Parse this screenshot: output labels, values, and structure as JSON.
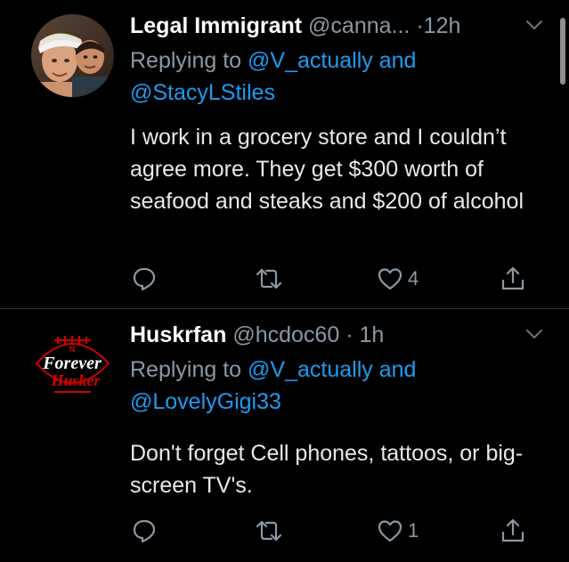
{
  "tweets": [
    {
      "name": "Legal Immigrant",
      "handle": "@canna...",
      "dot": "·",
      "time": "12h",
      "reply_prefix": "Replying to",
      "mention_1": "@V_actually and",
      "mention_2": "@StacyLStiles",
      "body": "I work in a grocery store and I couldn’t agree more. They get $300 worth of seafood and steaks and $200 of alcohol",
      "reply_count": "",
      "retweet_count": "",
      "like_count": "4"
    },
    {
      "name": "Huskrfan",
      "handle": "@hcdoc60",
      "dot": "·",
      "time": "1h",
      "reply_prefix": "Replying to",
      "mention_1": "@V_actually and",
      "mention_2": "@LovelyGigi33",
      "body": "Don't forget Cell phones, tattoos, or big-screen TV's.",
      "reply_count": "",
      "retweet_count": "",
      "like_count": "1",
      "avatar_logo_line_1": "Forever",
      "avatar_logo_line_2": "Husker"
    }
  ],
  "icons": {
    "reply": "speech-bubble-icon",
    "retweet": "retweet-arrows-icon",
    "like": "heart-outline-icon",
    "share": "share-upload-icon",
    "menu": "chevron-down-icon"
  },
  "colors": {
    "background": "#000000",
    "name": "#ffffff",
    "secondary_text": "#8b98a5",
    "body_text": "#e7e9ea",
    "mention": "#1d9bf0",
    "separator": "#2f3336",
    "husker_red": "#d00000"
  }
}
